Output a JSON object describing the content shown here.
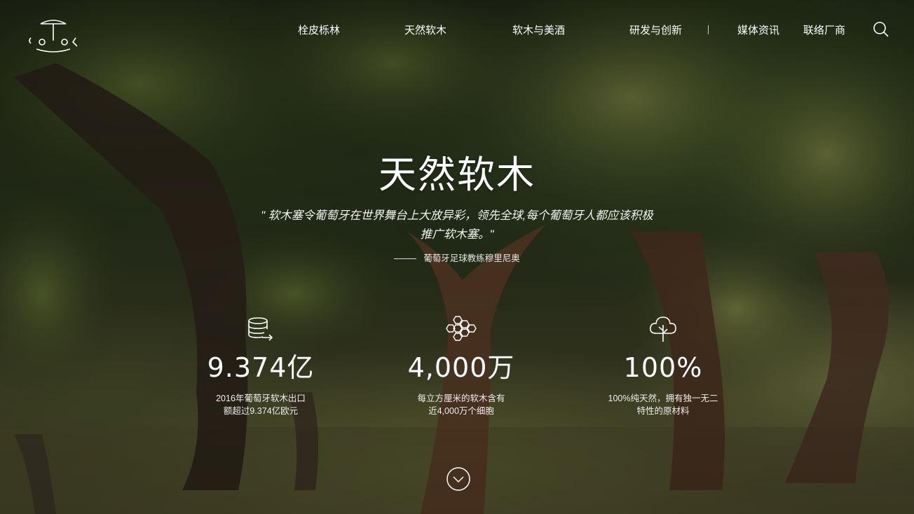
{
  "logo": {
    "text": "CORK",
    "icon": "cork-logo"
  },
  "nav": {
    "items": [
      {
        "label": "栓皮栎林"
      },
      {
        "label": "天然软木"
      },
      {
        "label": "软木与美酒"
      },
      {
        "label": "研发与创新"
      },
      {
        "label": "媒体资讯"
      },
      {
        "label": "联络厂商"
      }
    ],
    "search_icon": "search-icon"
  },
  "hero": {
    "title": "天然软木",
    "quote_line1": "\" 软木塞令葡萄牙在世界舞台上大放异彩，领先全球,每个葡萄牙人都应该积极",
    "quote_line2": "推广软木塞。\"",
    "author": "葡萄牙足球教练穆里尼奥"
  },
  "stats": [
    {
      "icon": "database-export-icon",
      "value": "9.374亿",
      "desc_line1": "2016年葡萄牙软木出口",
      "desc_line2": "额超过9.374亿欧元"
    },
    {
      "icon": "honeycomb-cells-icon",
      "value": "4,000万",
      "desc_line1": "每立方厘米的软木含有",
      "desc_line2": "近4,000万个细胞"
    },
    {
      "icon": "tree-icon",
      "value": "100%",
      "desc_line1": "100%纯天然，拥有独一无二",
      "desc_line2": "特性的原材料"
    }
  ],
  "scroll_icon": "chevron-down-icon",
  "colors": {
    "text": "#ffffff",
    "overlay": "#000000"
  }
}
